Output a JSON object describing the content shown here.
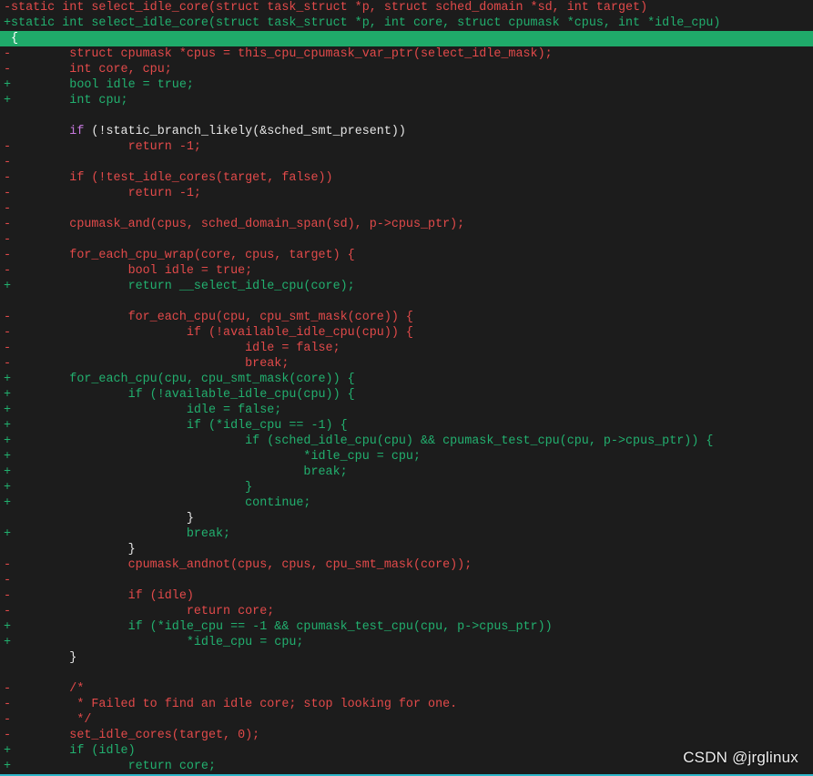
{
  "diff_lines": [
    {
      "t": "del",
      "m": "-",
      "s": "static int select_idle_core(struct task_struct *p, struct sched_domain *sd, int target)"
    },
    {
      "t": "add",
      "m": "+",
      "s": "static int select_idle_core(struct task_struct *p, int core, struct cpumask *cpus, int *idle_cpu)"
    },
    {
      "t": "hl",
      "m": "",
      "s": "{"
    },
    {
      "t": "del",
      "m": "-",
      "s": "        struct cpumask *cpus = this_cpu_cpumask_var_ptr(select_idle_mask);"
    },
    {
      "t": "del",
      "m": "-",
      "s": "        int core, cpu;"
    },
    {
      "t": "add",
      "m": "+",
      "s": "        bool idle = true;"
    },
    {
      "t": "add",
      "m": "+",
      "s": "        int cpu;"
    },
    {
      "t": "ctx",
      "m": "",
      "s": ""
    },
    {
      "t": "ctx",
      "m": "",
      "s": "        if (!static_branch_likely(&sched_smt_present))",
      "kw": true
    },
    {
      "t": "del",
      "m": "-",
      "s": "                return -1;"
    },
    {
      "t": "del",
      "m": "-",
      "s": ""
    },
    {
      "t": "del",
      "m": "-",
      "s": "        if (!test_idle_cores(target, false))"
    },
    {
      "t": "del",
      "m": "-",
      "s": "                return -1;"
    },
    {
      "t": "del",
      "m": "-",
      "s": ""
    },
    {
      "t": "del",
      "m": "-",
      "s": "        cpumask_and(cpus, sched_domain_span(sd), p->cpus_ptr);"
    },
    {
      "t": "del",
      "m": "-",
      "s": ""
    },
    {
      "t": "del",
      "m": "-",
      "s": "        for_each_cpu_wrap(core, cpus, target) {"
    },
    {
      "t": "del",
      "m": "-",
      "s": "                bool idle = true;"
    },
    {
      "t": "add",
      "m": "+",
      "s": "                return __select_idle_cpu(core);"
    },
    {
      "t": "ctx",
      "m": "",
      "s": ""
    },
    {
      "t": "del",
      "m": "-",
      "s": "                for_each_cpu(cpu, cpu_smt_mask(core)) {"
    },
    {
      "t": "del",
      "m": "-",
      "s": "                        if (!available_idle_cpu(cpu)) {"
    },
    {
      "t": "del",
      "m": "-",
      "s": "                                idle = false;"
    },
    {
      "t": "del",
      "m": "-",
      "s": "                                break;"
    },
    {
      "t": "add",
      "m": "+",
      "s": "        for_each_cpu(cpu, cpu_smt_mask(core)) {"
    },
    {
      "t": "add",
      "m": "+",
      "s": "                if (!available_idle_cpu(cpu)) {"
    },
    {
      "t": "add",
      "m": "+",
      "s": "                        idle = false;"
    },
    {
      "t": "add",
      "m": "+",
      "s": "                        if (*idle_cpu == -1) {"
    },
    {
      "t": "add",
      "m": "+",
      "s": "                                if (sched_idle_cpu(cpu) && cpumask_test_cpu(cpu, p->cpus_ptr)) {"
    },
    {
      "t": "add",
      "m": "+",
      "s": "                                        *idle_cpu = cpu;"
    },
    {
      "t": "add",
      "m": "+",
      "s": "                                        break;"
    },
    {
      "t": "add",
      "m": "+",
      "s": "                                }"
    },
    {
      "t": "add",
      "m": "+",
      "s": "                                continue;"
    },
    {
      "t": "ctx",
      "m": "",
      "s": "                        }"
    },
    {
      "t": "add",
      "m": "+",
      "s": "                        break;"
    },
    {
      "t": "ctx",
      "m": "",
      "s": "                }"
    },
    {
      "t": "del",
      "m": "-",
      "s": "                cpumask_andnot(cpus, cpus, cpu_smt_mask(core));"
    },
    {
      "t": "del",
      "m": "-",
      "s": ""
    },
    {
      "t": "del",
      "m": "-",
      "s": "                if (idle)"
    },
    {
      "t": "del",
      "m": "-",
      "s": "                        return core;"
    },
    {
      "t": "add",
      "m": "+",
      "s": "                if (*idle_cpu == -1 && cpumask_test_cpu(cpu, p->cpus_ptr))"
    },
    {
      "t": "add",
      "m": "+",
      "s": "                        *idle_cpu = cpu;"
    },
    {
      "t": "ctx",
      "m": "",
      "s": "        }"
    },
    {
      "t": "ctx",
      "m": "",
      "s": ""
    },
    {
      "t": "del",
      "m": "-",
      "s": "        /*"
    },
    {
      "t": "del",
      "m": "-",
      "s": "         * Failed to find an idle core; stop looking for one."
    },
    {
      "t": "del",
      "m": "-",
      "s": "         */"
    },
    {
      "t": "del",
      "m": "-",
      "s": "        set_idle_cores(target, 0);"
    },
    {
      "t": "add",
      "m": "+",
      "s": "        if (idle)"
    },
    {
      "t": "add",
      "m": "+",
      "s": "                return core;"
    }
  ],
  "watermark": "CSDN @jrglinux",
  "colors": {
    "background": "#1c1c1c",
    "removed": "#e24a4a",
    "added": "#22b06f",
    "context": "#e6e6e6",
    "highlight": "#1faa6a"
  }
}
